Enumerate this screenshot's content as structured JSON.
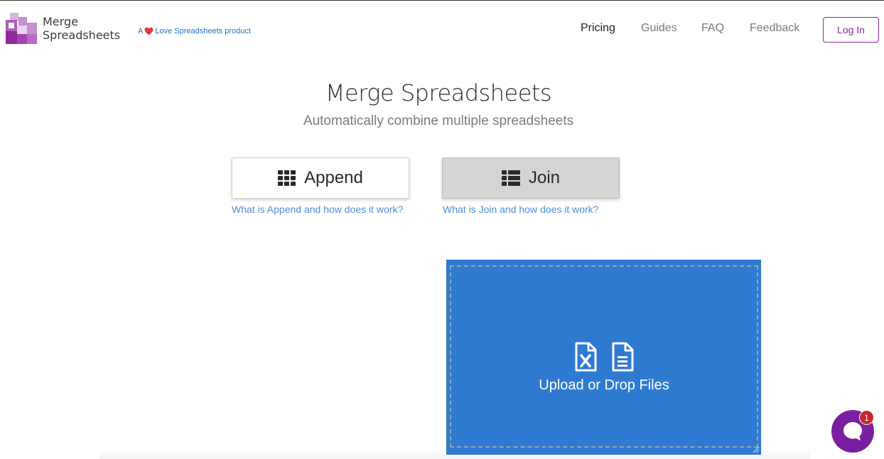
{
  "brand": {
    "line1": "Merge",
    "line2": "Spreadsheets",
    "tagline_prefix": "A",
    "tagline_suffix": "Love Spreadsheets product",
    "colors": {
      "logo_dark": "#8e2a9c",
      "logo_mid": "#b05cbf",
      "logo_light": "#d8b3de"
    }
  },
  "nav": {
    "items": [
      {
        "label": "Pricing",
        "active": true
      },
      {
        "label": "Guides",
        "active": false
      },
      {
        "label": "FAQ",
        "active": false
      },
      {
        "label": "Feedback",
        "active": false
      }
    ],
    "login_label": "Log In"
  },
  "hero": {
    "title": "Merge Spreadsheets",
    "subtitle": "Automatically combine multiple spreadsheets"
  },
  "modes": {
    "append": {
      "label": "Append",
      "icon": "th-grid-icon",
      "help": "What is Append and how does it work?"
    },
    "join": {
      "label": "Join",
      "icon": "th-list-icon",
      "help": "What is Join and how does it work?",
      "selected": true
    }
  },
  "dropzone": {
    "label": "Upload or Drop Files",
    "icons": [
      "excel-file-icon",
      "text-file-icon"
    ],
    "background": "#2f7ad1"
  },
  "chat": {
    "badge_count": "1",
    "color": "#7b1fa2"
  }
}
